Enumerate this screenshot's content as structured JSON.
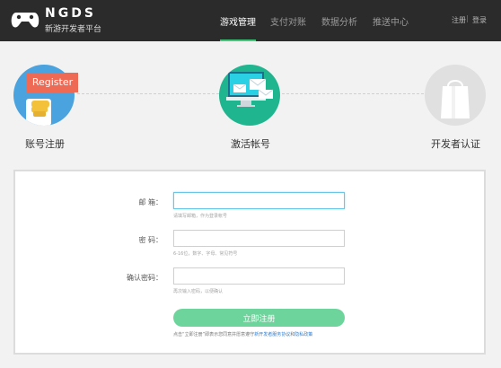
{
  "header": {
    "logo_title": "NGDS",
    "logo_subtitle": "新游开发者平台",
    "nav": [
      {
        "label": "游戏管理",
        "active": true
      },
      {
        "label": "支付对账",
        "active": false
      },
      {
        "label": "数据分析",
        "active": false
      },
      {
        "label": "推送中心",
        "active": false
      }
    ],
    "register": "注册",
    "separator": "|",
    "login": "登录"
  },
  "steps": [
    {
      "label": "账号注册",
      "badge": "Register",
      "icon": "register-hand-icon"
    },
    {
      "label": "激活帐号",
      "icon": "monitor-mail-icon"
    },
    {
      "label": "开发者认证",
      "icon": "shopping-bag-icon"
    }
  ],
  "form": {
    "email_label": "邮 箱：",
    "email_hint": "请填写邮箱，作为登录帐号",
    "password_label": "密 码：",
    "password_hint": "6-16位，数字、字母、常见符号",
    "confirm_label": "确认密码：",
    "confirm_hint": "再次输入密码，以便确认",
    "submit": "立即注册",
    "agree_prefix": "点击“立即注册”即表示您同意并愿意遵守",
    "agree_link1": "新开发者服务协议",
    "agree_mid": "和",
    "agree_link2": "隐私政策"
  },
  "colors": {
    "header_bg": "#2b2b2b",
    "accent_green": "#3ec87a",
    "button_green": "#6dd59c",
    "step1_bg": "#4aa3df",
    "step2_bg": "#1fb58f",
    "step3_bg": "#e0e0e0",
    "badge_red": "#ef6a55",
    "link_blue": "#2d7fd0"
  }
}
